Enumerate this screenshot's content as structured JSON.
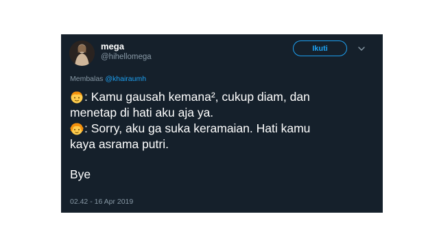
{
  "tweet": {
    "author_name": "mega",
    "author_handle": "@hihellomega",
    "follow_label": "Ikuti",
    "reply_prefix": "Membalas",
    "reply_to": "@khairaumh",
    "line1": ": Kamu gausah kemana², cukup diam, dan",
    "line2": "menetap di hati aku aja ya.",
    "line3": ": Sorry, aku ga suka keramaian. Hati kamu",
    "line4": "kaya asrama putri.",
    "line5": "Bye",
    "timestamp": "02.42 - 16 Apr 2019"
  },
  "icons": {
    "emoji1": "boy-emoji",
    "emoji2": "girl-emoji",
    "menu": "chevron-down-icon"
  },
  "colors": {
    "card_background": "#15202b",
    "accent": "#1da1f2",
    "secondary_text": "#8899a6",
    "text": "#ffffff"
  }
}
